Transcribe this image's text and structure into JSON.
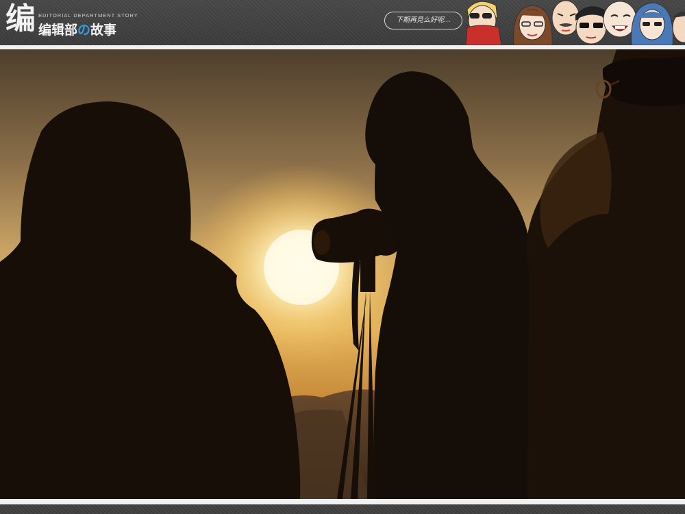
{
  "header": {
    "logo_glyph": "编",
    "logo_en": "EDITORIAL DEPARTMENT STORY",
    "logo_cn_a": "编辑部",
    "logo_cn_no": "の",
    "logo_cn_b": "故事",
    "bubble_text": "下期再見么好呢…",
    "faces": [
      "face-sunglasses-scarf",
      "face-long-hair",
      "face-bald-mustache",
      "face-glasses-black-hair",
      "face-round-bald",
      "face-blue-hair-glasses",
      "face-partial"
    ]
  },
  "photo": {
    "subject_icons": [
      "hooded-silhouette",
      "photographer-silhouette",
      "camera-on-tripod",
      "fur-hood-silhouette",
      "sun",
      "mountains"
    ]
  }
}
